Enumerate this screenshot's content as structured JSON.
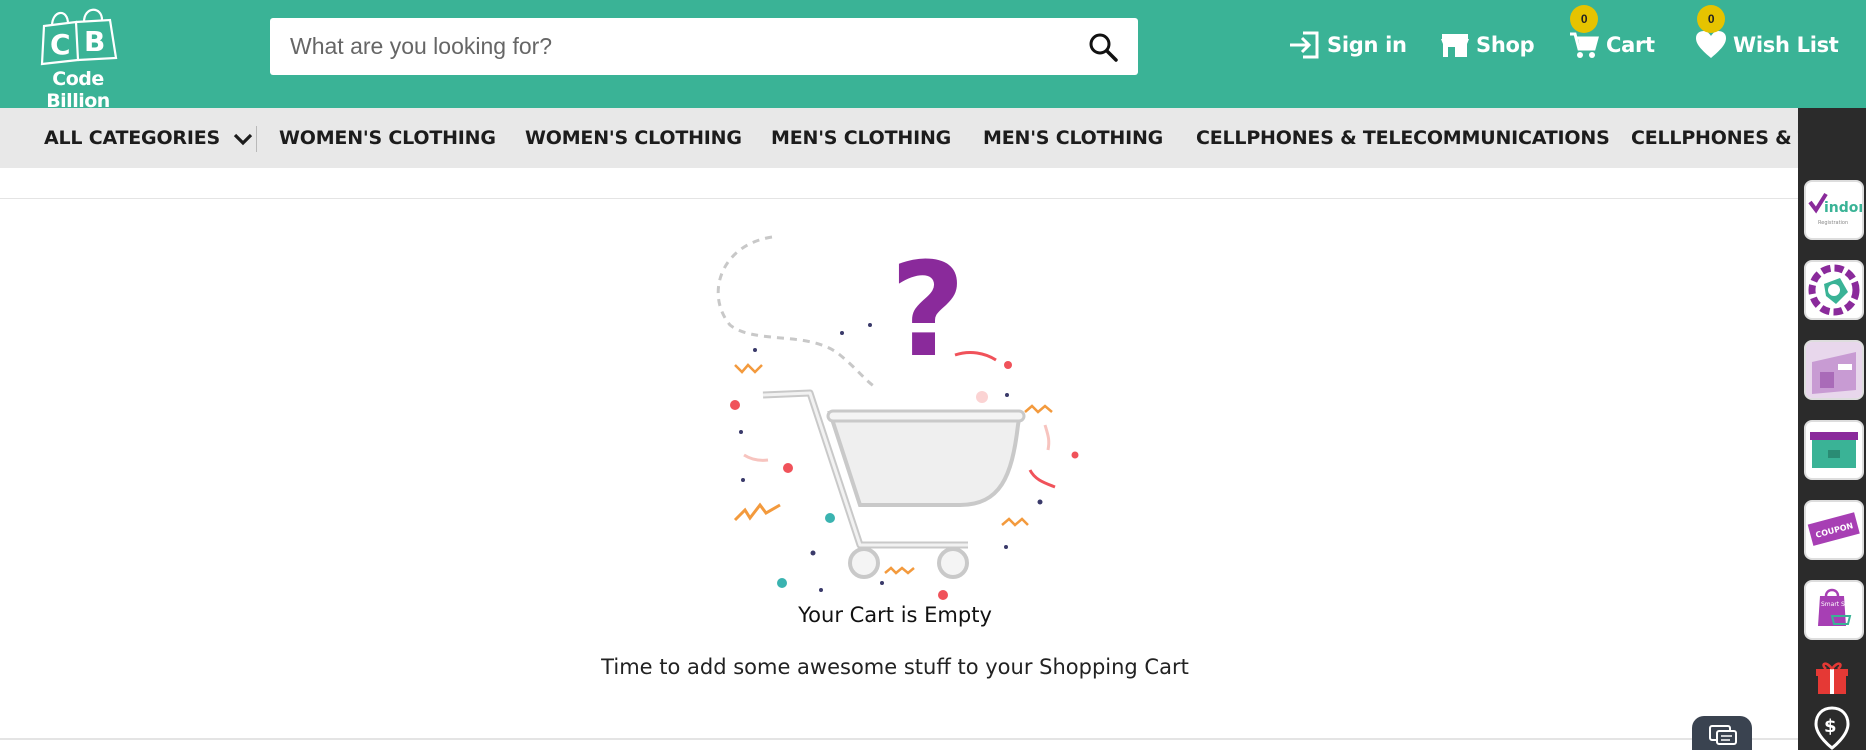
{
  "brand": {
    "name": "Code Billion",
    "logo_letters": "CB",
    "color": "#3ab396"
  },
  "search": {
    "placeholder": "What are you looking for?",
    "icon": "search-icon"
  },
  "header_nav": {
    "signin": {
      "label": "Sign in",
      "icon": "sign-in-icon"
    },
    "shop": {
      "label": "Shop",
      "icon": "store-icon"
    },
    "cart": {
      "label": "Cart",
      "icon": "cart-icon",
      "count": "0"
    },
    "wishlist": {
      "label": "Wish List",
      "icon": "heart-icon",
      "count": "0"
    }
  },
  "categories": {
    "all": {
      "label": "ALL CATEGORIES",
      "icon": "chevron-down-icon"
    },
    "items": [
      "WOMEN'S CLOTHING",
      "WOMEN'S CLOTHING",
      "MEN'S CLOTHING",
      "MEN'S CLOTHING",
      "CELLPHONES & TELECOMMUNICATIONS",
      "CELLPHONES & TELECOMMUNICATIONS"
    ]
  },
  "cart_empty": {
    "title": "Your Cart is Empty",
    "subtitle": "Time to add some awesome stuff to your Shopping Cart",
    "illustration": "empty-cart-illustration"
  },
  "right_rail": {
    "tiles": [
      {
        "icon": "vendor-registration-icon",
        "text": "indor",
        "subtext": "Registration"
      },
      {
        "icon": "saudi-map-gear-icon"
      },
      {
        "icon": "storefront-icon"
      },
      {
        "icon": "teal-box-icon"
      },
      {
        "icon": "coupon-icon",
        "text": "COUPON"
      },
      {
        "icon": "smart-shop-bag-icon",
        "text": "Smart Shop"
      }
    ],
    "gift_icon": "gift-icon",
    "location_icon": "location-pin-icon"
  },
  "chat": {
    "icon": "chat-icon"
  },
  "colors": {
    "accent": "#3ab396",
    "badge": "#e6c300",
    "question_mark": "#8a2a9b",
    "rail": "#2b2b2b"
  }
}
